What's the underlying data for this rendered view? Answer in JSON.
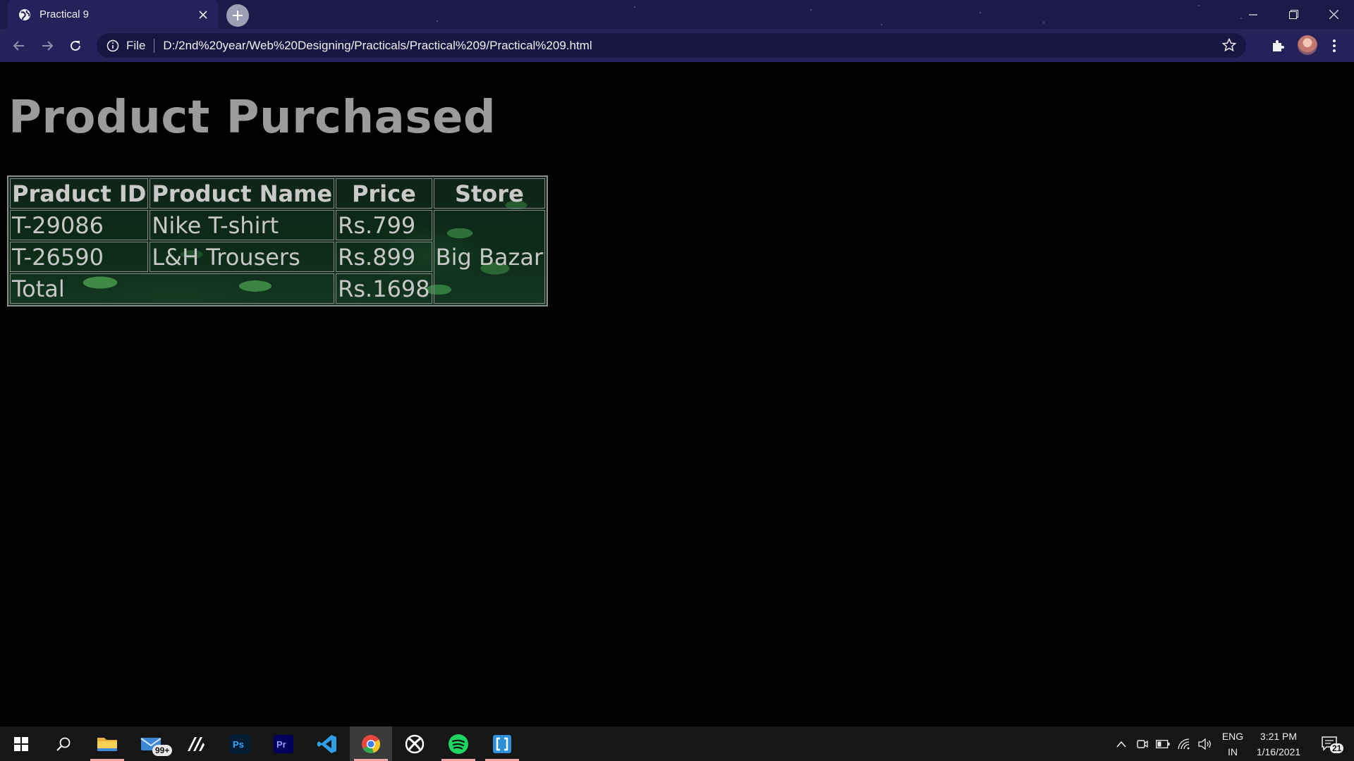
{
  "browser": {
    "tab_title": "Practical 9",
    "url_scheme": "File",
    "url": "D:/2nd%20year/Web%20Designing/Practicals/Practical%209/Practical%209.html"
  },
  "page": {
    "heading": "Product Purchased",
    "table": {
      "headers": [
        "Praduct ID",
        "Product Name",
        "Price",
        "Store"
      ],
      "rows": [
        [
          "T-29086",
          "Nike T-shirt",
          "Rs.799"
        ],
        [
          "T-26590",
          "L&H Trousers",
          "Rs.899"
        ]
      ],
      "store": "Big Bazar",
      "total_label": "Total",
      "total_value": "Rs.1698"
    }
  },
  "taskbar": {
    "mail_badge": "99+",
    "lang": "ENG",
    "region": "IN",
    "time": "3:21 PM",
    "date": "1/16/2021",
    "notifications": "21",
    "apps": [
      "start",
      "search",
      "file-explorer",
      "mail",
      "vector-app",
      "photoshop",
      "premiere",
      "vscode",
      "chrome",
      "xbox",
      "spotify",
      "snip-tool"
    ]
  },
  "colors": {
    "tabstrip": "#1d1a4a",
    "toolbar": "#25215a",
    "page_bg": "#000000",
    "heading": "#9b9b9b",
    "taskbar": "#161616"
  }
}
